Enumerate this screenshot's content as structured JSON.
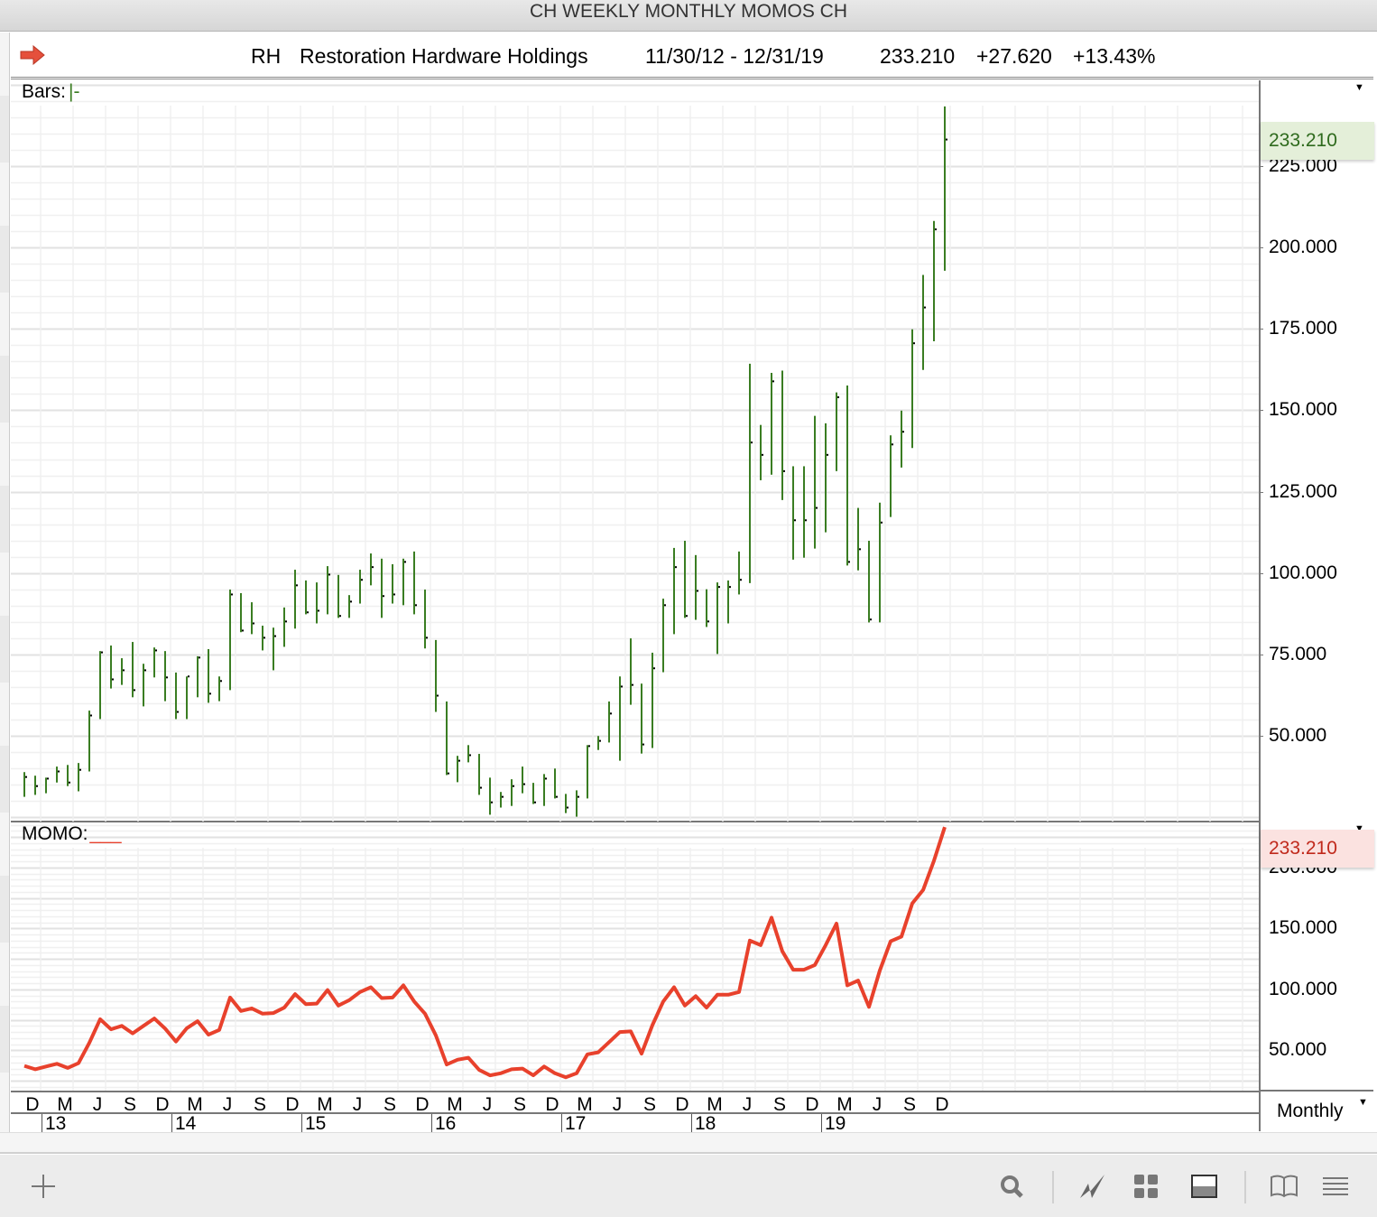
{
  "window_title": "CH WEEKLY MONTHLY MOMOS CH",
  "header": {
    "symbol": "RH",
    "company": "Restoration Hardware Holdings",
    "date_range": "11/30/12 - 12/31/19",
    "last": "233.210",
    "change": "+27.620",
    "change_pct": "+13.43%",
    "icon": "red-arrow-right-icon"
  },
  "price_panel": {
    "label": "Bars:",
    "label_suffix": "|-",
    "last_value": "233.210"
  },
  "momo_panel": {
    "label": "MOMO:",
    "label_suffix": "___",
    "last_value": "233.210"
  },
  "period_select": "Monthly",
  "colors": {
    "bars": "#3a7d22",
    "momo": "#e8412c",
    "last_price_bg": "#e4efd9",
    "last_momo_bg": "#fbe2e0"
  },
  "toolbar": [
    "add-icon",
    "search-icon",
    "chart-line-icon",
    "grid-icon",
    "panel-layout-icon",
    "book-icon",
    "menu-icon"
  ],
  "chart_data": [
    {
      "type": "ohlc",
      "title": "RH Restoration Hardware Holdings",
      "period": "Monthly",
      "start_month": "2012-11",
      "high": [
        38.8,
        37.7,
        37.1,
        40.5,
        41.0,
        41.6,
        57.7,
        76.0,
        77.7,
        73.8,
        78.8,
        72.1,
        77.1,
        76.0,
        69.4,
        68.2,
        74.4,
        76.6,
        68.2,
        94.9,
        93.8,
        91.0,
        83.8,
        83.2,
        89.4,
        101.0,
        97.7,
        97.1,
        102.1,
        99.4,
        93.2,
        101.0,
        106.0,
        104.4,
        102.7,
        104.4,
        106.6,
        94.9,
        79.4,
        60.5,
        43.8,
        47.1,
        44.4,
        37.1,
        32.7,
        36.6,
        40.5,
        35.5,
        38.2,
        39.9,
        32.1,
        33.2,
        47.1,
        49.9,
        60.5,
        68.2,
        79.9,
        66.0,
        75.5,
        92.1,
        107.7,
        109.9,
        105.5,
        95.0,
        97.1,
        97.7,
        106.6,
        164.3,
        145.5,
        161.5,
        162.2,
        132.8,
        132.8,
        148.3,
        146.0,
        155.5,
        157.6,
        120.0,
        109.9,
        121.6,
        142.3,
        149.9,
        174.9,
        191.6,
        208.2,
        243.4
      ],
      "low": [
        31.2,
        31.8,
        32.3,
        35.6,
        34.5,
        32.9,
        39.0,
        55.1,
        64.5,
        65.6,
        61.8,
        59.0,
        67.9,
        60.6,
        55.1,
        55.1,
        61.8,
        60.1,
        60.6,
        64.0,
        81.8,
        81.2,
        76.2,
        70.1,
        77.3,
        82.9,
        87.3,
        84.5,
        87.3,
        86.2,
        86.2,
        90.6,
        96.2,
        86.2,
        90.6,
        90.1,
        87.3,
        76.8,
        57.3,
        37.9,
        35.7,
        41.8,
        31.8,
        25.7,
        27.9,
        28.4,
        32.3,
        29.0,
        28.4,
        30.7,
        26.2,
        25.1,
        30.7,
        45.6,
        47.9,
        42.3,
        59.5,
        44.5,
        46.2,
        69.5,
        81.2,
        86.2,
        85.6,
        83.4,
        75.1,
        84.5,
        93.4,
        96.9,
        128.5,
        130.2,
        122.4,
        104.1,
        104.7,
        107.5,
        112.5,
        131.3,
        102.3,
        100.8,
        84.8,
        84.8,
        117.2,
        132.4,
        138.4,
        162.4,
        171.2,
        192.9
      ],
      "close": [
        37.3,
        34.5,
        36.8,
        39.0,
        35.6,
        39.5,
        56.2,
        75.6,
        67.3,
        70.1,
        64.0,
        70.1,
        76.2,
        67.9,
        57.3,
        68.2,
        74.0,
        62.9,
        66.8,
        93.4,
        82.3,
        84.5,
        80.1,
        80.6,
        85.1,
        96.2,
        87.9,
        88.4,
        99.5,
        86.8,
        91.2,
        97.9,
        101.8,
        92.9,
        93.4,
        103.4,
        90.1,
        80.1,
        62.3,
        38.4,
        42.3,
        44.0,
        34.0,
        29.5,
        31.2,
        34.5,
        35.1,
        29.5,
        36.8,
        31.2,
        27.9,
        31.2,
        46.8,
        48.4,
        56.8,
        65.1,
        65.6,
        47.3,
        70.7,
        90.1,
        101.8,
        86.8,
        94.5,
        85.1,
        95.7,
        95.7,
        97.9,
        140.1,
        136.3,
        158.9,
        131.3,
        116.2,
        116.2,
        120.0,
        136.3,
        154.0,
        103.4,
        107.3,
        85.7,
        115.5,
        139.5,
        143.4,
        170.6,
        181.6,
        205.6,
        233.21
      ],
      "ylim": [
        23.6,
        251.4
      ],
      "yticks": [
        "225.000",
        "200.000",
        "175.000",
        "150.000",
        "125.000",
        "100.000",
        "75.000",
        "50.000"
      ],
      "ytick_values": [
        225,
        200,
        175,
        150,
        125,
        100,
        75,
        50
      ],
      "grid": true
    },
    {
      "type": "line",
      "name": "MOMO",
      "source": "close",
      "ylim": [
        17,
        237
      ],
      "yticks": [
        "200.000",
        "150.000",
        "100.000",
        "50.000"
      ],
      "ytick_values": [
        200,
        150,
        100,
        50
      ],
      "grid": true
    }
  ],
  "x_axis": {
    "month_ticks": [
      "D",
      "M",
      "J",
      "S",
      "D",
      "M",
      "J",
      "S",
      "D",
      "M",
      "J",
      "S",
      "D",
      "M",
      "J",
      "S",
      "D",
      "M",
      "J",
      "S",
      "D",
      "M",
      "J",
      "S",
      "D",
      "M",
      "J",
      "S",
      "D"
    ],
    "year_ticks": [
      "13",
      "14",
      "15",
      "16",
      "17",
      "18",
      "19"
    ]
  }
}
